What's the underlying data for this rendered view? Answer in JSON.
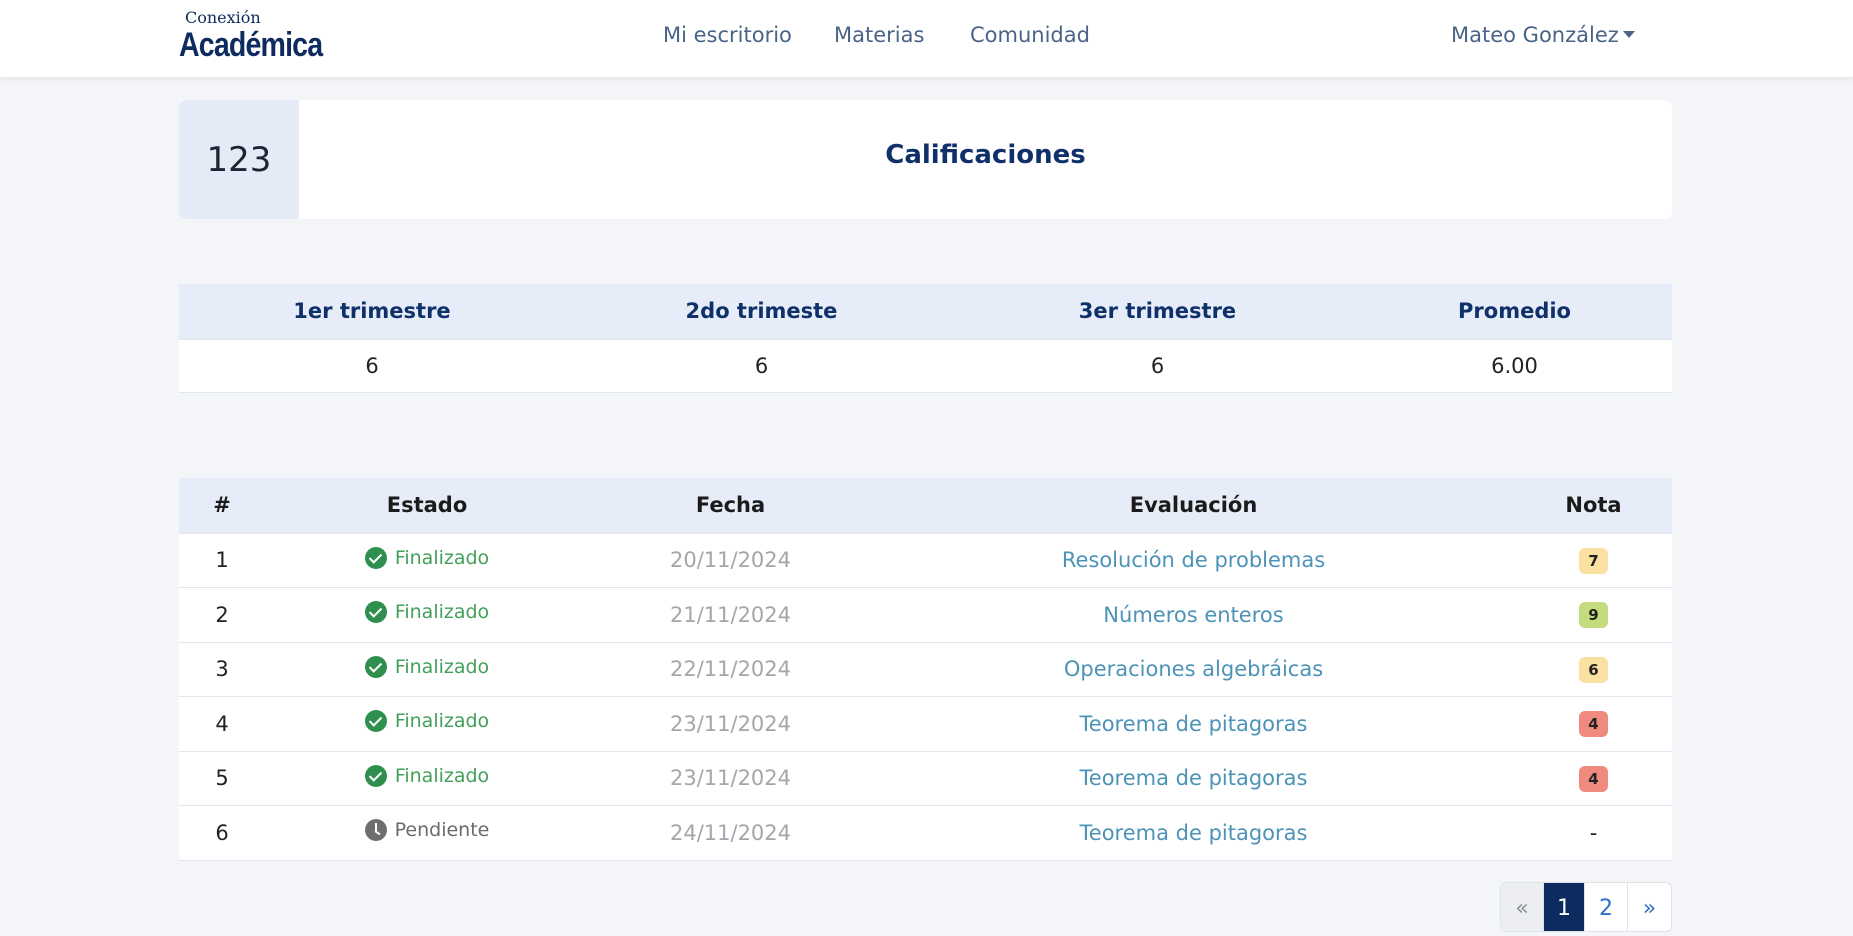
{
  "navbar": {
    "logo_top": "Conexión",
    "logo_main": "Académica",
    "links": [
      {
        "label": "Mi escritorio"
      },
      {
        "label": "Materias"
      },
      {
        "label": "Comunidad"
      }
    ],
    "user_name": "Mateo González"
  },
  "header": {
    "icon_text": "123",
    "title": "Calificaciones"
  },
  "trimestres": {
    "headers": [
      "1er trimestre",
      "2do trimeste",
      "3er trimestre",
      "Promedio"
    ],
    "values": [
      "6",
      "6",
      "6",
      "6.00"
    ]
  },
  "evaluaciones": {
    "headers": [
      "#",
      "Estado",
      "Fecha",
      "Evaluación",
      "Nota"
    ],
    "rows": [
      {
        "num": "1",
        "estado": "Finalizado",
        "status_icon": "check-circle-icon",
        "fecha": "20/11/2024",
        "evaluacion": "Resolución de problemas",
        "nota": "7",
        "nota_color": "#fbe1a1"
      },
      {
        "num": "2",
        "estado": "Finalizado",
        "status_icon": "check-circle-icon",
        "fecha": "21/11/2024",
        "evaluacion": "Números enteros",
        "nota": "9",
        "nota_color": "#c5dc7e"
      },
      {
        "num": "3",
        "estado": "Finalizado",
        "status_icon": "check-circle-icon",
        "fecha": "22/11/2024",
        "evaluacion": "Operaciones algebráicas",
        "nota": "6",
        "nota_color": "#fbe1a1"
      },
      {
        "num": "4",
        "estado": "Finalizado",
        "status_icon": "check-circle-icon",
        "fecha": "23/11/2024",
        "evaluacion": "Teorema de pitagoras",
        "nota": "4",
        "nota_color": "#f08a7e"
      },
      {
        "num": "5",
        "estado": "Finalizado",
        "status_icon": "check-circle-icon",
        "fecha": "23/11/2024",
        "evaluacion": "Teorema de pitagoras",
        "nota": "4",
        "nota_color": "#f08a7e"
      },
      {
        "num": "6",
        "estado": "Pendiente",
        "status_icon": "clock-icon",
        "fecha": "24/11/2024",
        "evaluacion": "Teorema de pitagoras",
        "nota": "-",
        "nota_color": ""
      }
    ]
  },
  "pagination": {
    "prev": "«",
    "pages": [
      "1",
      "2"
    ],
    "active_page": "1",
    "next": "»"
  },
  "colors": {
    "brand": "#0d2b5e",
    "status_ok": "#2f8f4e",
    "status_pending": "#6e6e6e",
    "link": "#4d93b8"
  }
}
